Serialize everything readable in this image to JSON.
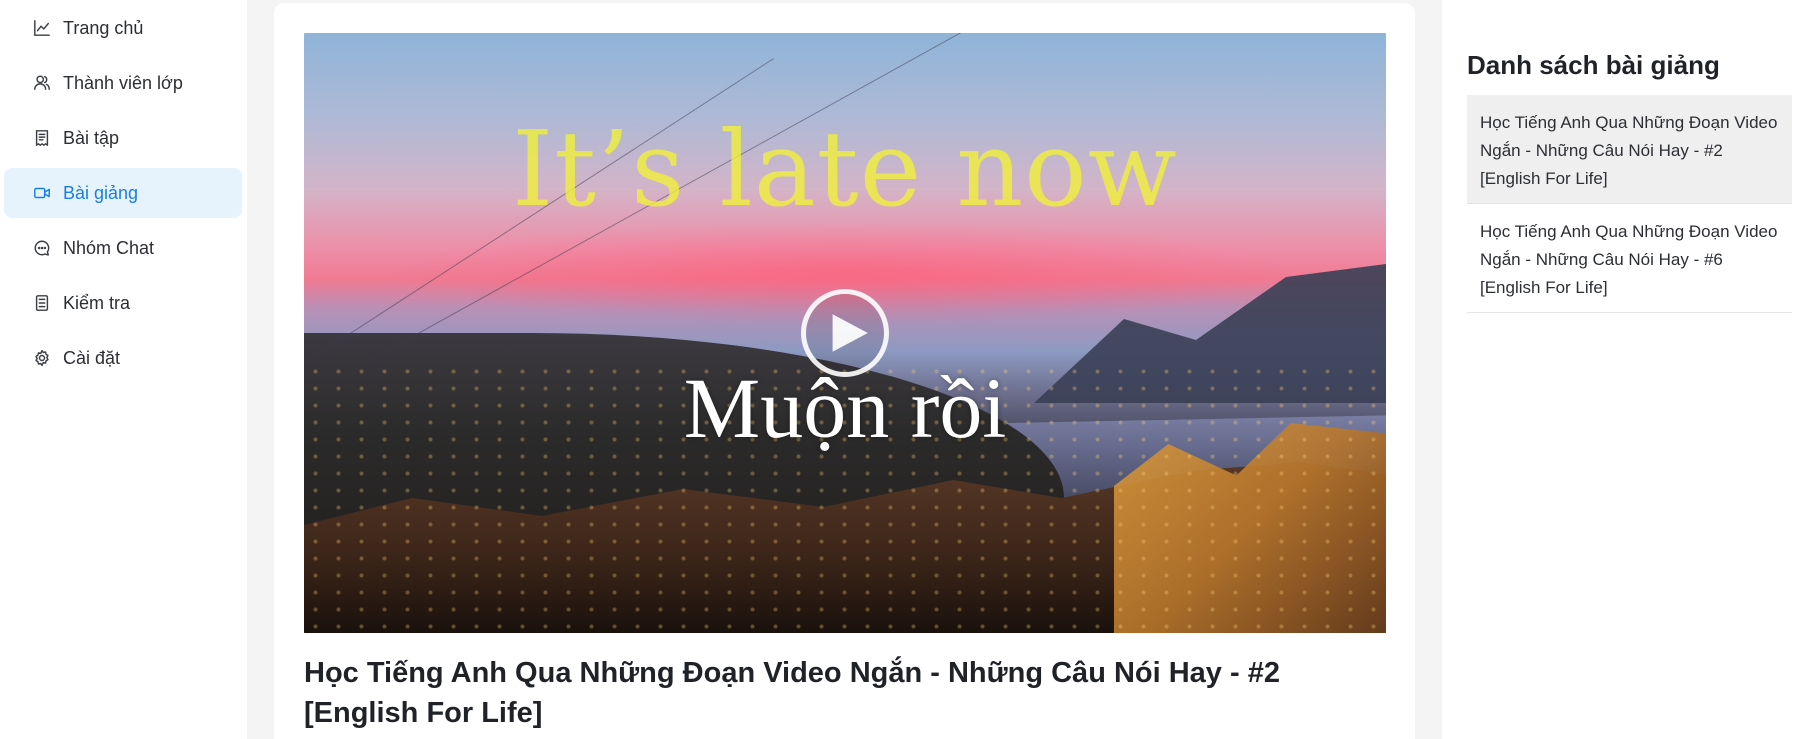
{
  "sidebar": {
    "items": [
      {
        "label": "Trang chủ",
        "icon": "chart-line-icon",
        "active": false
      },
      {
        "label": "Thành viên lớp",
        "icon": "users-icon",
        "active": false
      },
      {
        "label": "Bài tập",
        "icon": "receipt-icon",
        "active": false
      },
      {
        "label": "Bài giảng",
        "icon": "video-icon",
        "active": true
      },
      {
        "label": "Nhóm Chat",
        "icon": "chat-bubble-icon",
        "active": false
      },
      {
        "label": "Kiểm tra",
        "icon": "clipboard-list-icon",
        "active": false
      },
      {
        "label": "Cài đặt",
        "icon": "gear-icon",
        "active": false
      }
    ]
  },
  "video": {
    "caption_en": "It’s late now",
    "caption_vi": "Muộn rồi",
    "play_icon": "play-icon"
  },
  "main": {
    "title": "Học Tiếng Anh Qua Những Đoạn Video Ngắn - Những Câu Nói Hay - #2 [English For Life]"
  },
  "lessons": {
    "heading": "Danh sách bài giảng",
    "items": [
      {
        "title": "Học Tiếng Anh Qua Những Đoạn Video Ngắn - Những Câu Nói Hay - #2 [English For Life]",
        "selected": true
      },
      {
        "title": "Học Tiếng Anh Qua Những Đoạn Video Ngắn - Những Câu Nói Hay - #6 [English For Life]",
        "selected": false
      }
    ]
  },
  "colors": {
    "accent": "#1a7fe0",
    "active_bg": "#e6f3fd",
    "page_bg": "#f4f4f5",
    "caption_en": "#f1f13a"
  }
}
